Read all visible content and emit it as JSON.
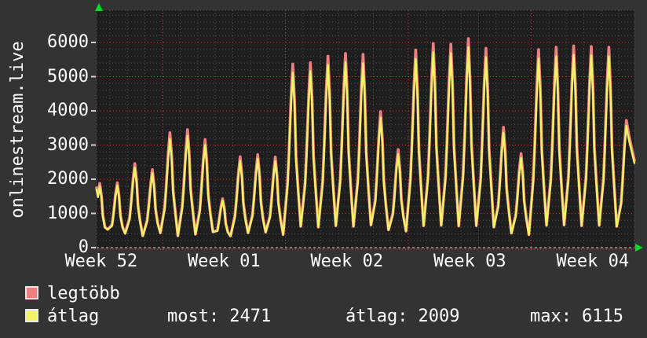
{
  "window": {
    "bg": "#333333",
    "plot_bg": "#1e1e1e",
    "text_color": "#ffffff",
    "arrow_color": "#00dd22"
  },
  "chart_data": {
    "type": "line",
    "ylabel": "onlinestream.live",
    "y_axis": {
      "tick_labels": [
        "0",
        "1000",
        "2000",
        "3000",
        "4000",
        "5000",
        "6000"
      ],
      "major_step": 1000,
      "minor_step": 200,
      "ylim": [
        0,
        6940
      ],
      "grid_major_color": "#c04646",
      "grid_minor_color": "#555555",
      "zero_line_color": "#cfcfcf"
    },
    "x_axis": {
      "tick_labels": [
        "Week 52",
        "Week 01",
        "Week 02",
        "Week 03",
        "Week 04"
      ],
      "week_line_days": [
        3.76,
        10.76,
        17.76,
        24.76
      ],
      "xlim_days": [
        0,
        30.64
      ],
      "minor_grid": "daily",
      "grid": true
    },
    "legend_position": "bottom-left",
    "series": [
      {
        "name": "legtöbb",
        "role": "max",
        "color": "#ee8080",
        "stroke_px": 3.6,
        "peak_day_offset": 0.18,
        "start": 1750,
        "end": 2550,
        "peaks": [
          1880,
          1900,
          2460,
          2280,
          3360,
          3450,
          3160,
          1430,
          2660,
          2720,
          2650,
          5370,
          5410,
          5600,
          5680,
          5650,
          3980,
          2870,
          5780,
          5970,
          5950,
          6115,
          5830,
          3520,
          2750,
          5790,
          5860,
          5900,
          5880,
          5860,
          3720
        ],
        "troughs": [
          430,
          530,
          415,
          345,
          430,
          345,
          390,
          460,
          340,
          430,
          450,
          380,
          620,
          600,
          640,
          620,
          660,
          520,
          480,
          640,
          650,
          630,
          640,
          600,
          420,
          380,
          650,
          660,
          640,
          650,
          620
        ]
      },
      {
        "name": "átlag",
        "role": "average",
        "color": "#f2f266",
        "stroke_px": 2.4,
        "peak_day_offset": 0.18,
        "start": 1700,
        "end": 2471,
        "peaks": [
          1800,
          1815,
          2340,
          2180,
          3180,
          3270,
          3000,
          1380,
          2540,
          2600,
          2530,
          5120,
          5160,
          5340,
          5430,
          5390,
          3800,
          2740,
          5520,
          5710,
          5690,
          5860,
          5570,
          3360,
          2620,
          5530,
          5600,
          5640,
          5620,
          5600,
          3560
        ],
        "troughs": [
          430,
          530,
          415,
          345,
          430,
          345,
          390,
          460,
          340,
          430,
          450,
          380,
          620,
          600,
          640,
          620,
          660,
          520,
          480,
          640,
          650,
          630,
          640,
          600,
          420,
          380,
          650,
          660,
          640,
          650,
          620
        ]
      }
    ],
    "stats": {
      "most_label": "most:",
      "most_value": "2471",
      "avg_label": "átlag:",
      "avg_value": "2009",
      "max_label": "max:",
      "max_value": "6115"
    }
  },
  "legend": {
    "items": [
      {
        "label": "legtöbb",
        "color": "#ee8080"
      },
      {
        "label": "átlag",
        "color": "#f2f266"
      }
    ]
  }
}
